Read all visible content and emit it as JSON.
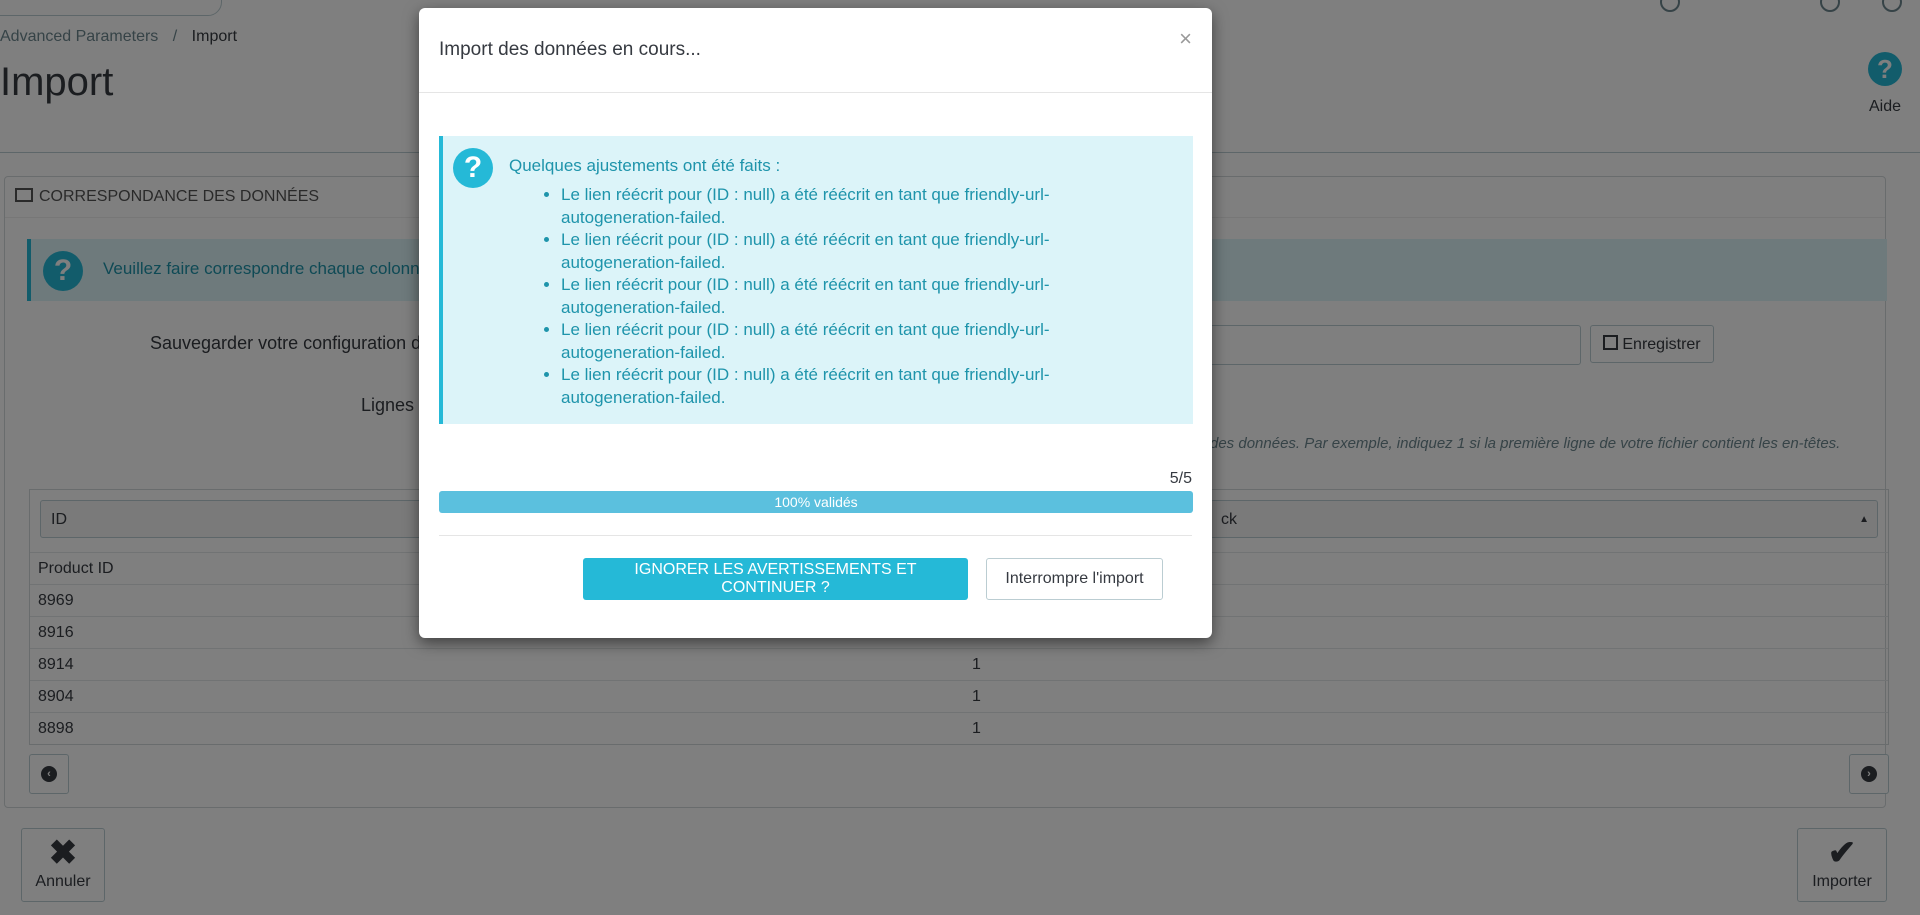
{
  "breadcrumb": {
    "parent": "Advanced Parameters",
    "separator": "/",
    "current": "Import"
  },
  "page_title": "Import",
  "help": {
    "label": "Aide"
  },
  "panel": {
    "heading": "Correspondance des données",
    "info_text": "Veuillez faire correspondre chaque colonne",
    "config_label": "Sauvegarder votre configuration d",
    "save_label": "Enregistrer",
    "rows_label": "Lignes à",
    "hint": "des données. Par exemple, indiquez 1 si la première ligne de votre fichier contient les en-têtes."
  },
  "grid": {
    "col1_select": "ID",
    "col2_select": "ck",
    "header_row": {
      "col1": "Product ID",
      "col2": ""
    },
    "rows": [
      {
        "col1": "8969",
        "col2": ""
      },
      {
        "col1": "8916",
        "col2": ""
      },
      {
        "col1": "8914",
        "col2": "1"
      },
      {
        "col1": "8904",
        "col2": "1"
      },
      {
        "col1": "8898",
        "col2": "1"
      }
    ]
  },
  "footer": {
    "cancel_label": "Annuler",
    "import_label": "Importer"
  },
  "modal": {
    "title": "Import des données en cours...",
    "close": "×",
    "alert_title": "Quelques ajustements ont été faits :",
    "warnings": [
      "Le lien réécrit pour (ID : null) a été réécrit en tant que friendly-url-autogeneration-failed.",
      "Le lien réécrit pour (ID : null) a été réécrit en tant que friendly-url-autogeneration-failed.",
      "Le lien réécrit pour (ID : null) a été réécrit en tant que friendly-url-autogeneration-failed.",
      "Le lien réécrit pour (ID : null) a été réécrit en tant que friendly-url-autogeneration-failed.",
      "Le lien réécrit pour (ID : null) a été réécrit en tant que friendly-url-autogeneration-failed."
    ],
    "counter": "5/5",
    "progress_percent": 100,
    "progress_label": "100% validés",
    "ignore_button": "IGNORER LES AVERTISSEMENTS ET CONTINUER ?",
    "abort_button": "Interrompre l'import"
  },
  "colors": {
    "accent": "#25b9d7",
    "alert_bg": "#dcf4f9",
    "alert_text": "#1e94ab",
    "progress": "#5bc0de"
  }
}
